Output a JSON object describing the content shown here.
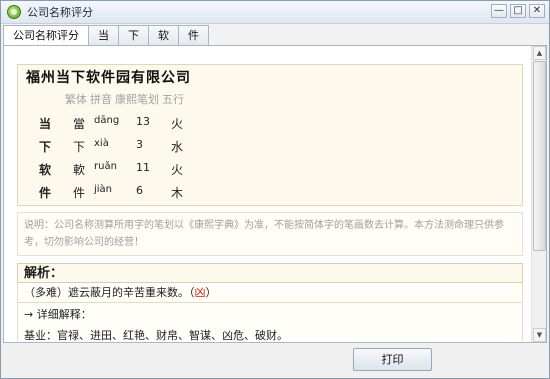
{
  "window": {
    "title": "公司名称评分",
    "min": "—",
    "max": "□",
    "close": "✕"
  },
  "tabs": [
    {
      "label": "公司名称评分"
    },
    {
      "label": "当"
    },
    {
      "label": "下"
    },
    {
      "label": "软"
    },
    {
      "label": "件"
    }
  ],
  "company": {
    "name": "福州当下软件园有限公司"
  },
  "columns": [
    "繁体",
    "拼音",
    "康熙笔划",
    "五行"
  ],
  "chars": [
    {
      "simp": "当",
      "trad": "當",
      "pinyin": "dāng",
      "strokes": "13",
      "element": "火"
    },
    {
      "simp": "下",
      "trad": "下",
      "pinyin": "xià",
      "strokes": "3",
      "element": "水"
    },
    {
      "simp": "软",
      "trad": "軟",
      "pinyin": "ruǎn",
      "strokes": "11",
      "element": "火"
    },
    {
      "simp": "件",
      "trad": "件",
      "pinyin": "jiàn",
      "strokes": "6",
      "element": "木"
    }
  ],
  "note": "说明：公司名称测算所用字的笔划以《康熙字典》为准，不能按简体字的笔画数去计算。本方法测命理只供参考，切勿影响公司的经营！",
  "analysis": {
    "heading": "解析：",
    "summary": "（多难）遮云蔽月的辛苦重来数。（",
    "verdict": "凶",
    "summary_end": "）",
    "detail_title": "→ 详细解释：",
    "detail_text": "基业：官禄、进田、红艳、财帛、智谋、凶危、破财。"
  },
  "colors": {
    "bad": "#dd1111"
  },
  "footer": {
    "print_label": "打印"
  }
}
